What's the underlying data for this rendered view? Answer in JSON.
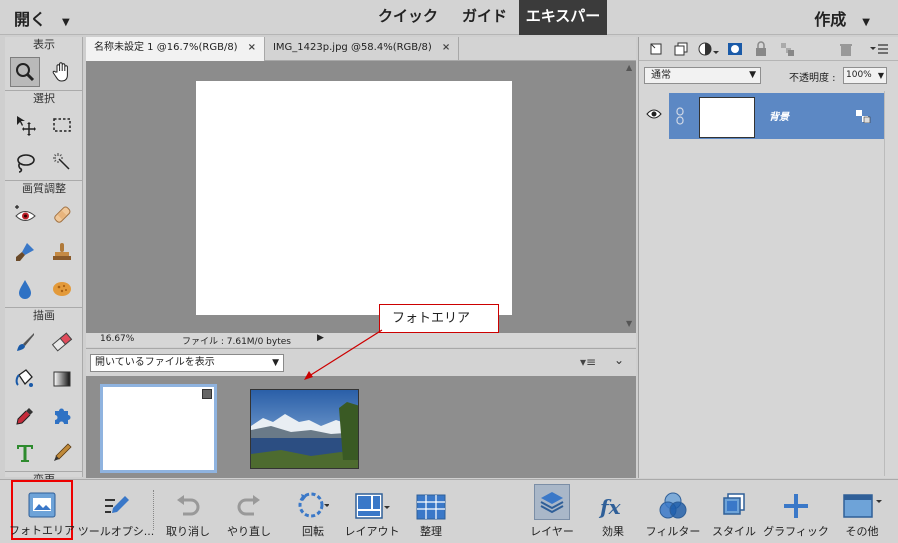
{
  "topbar": {
    "open_label": "開く",
    "modes": [
      "クイック",
      "ガイド",
      "エキスパート"
    ],
    "active_mode": "エキスパート",
    "create_label": "作成"
  },
  "toolbox": {
    "sections": {
      "view": "表示",
      "select": "選択",
      "enhance": "画質調整",
      "draw": "描画",
      "modify": "変更"
    }
  },
  "document": {
    "tabs": [
      {
        "label": "名称未設定 1 @16.7%(RGB/8)",
        "active": true
      },
      {
        "label": "IMG_1423p.jpg @58.4%(RGB/8)",
        "active": false
      }
    ],
    "status_zoom": "16.67%",
    "status_file": "ファイル : 7.61M/0 bytes"
  },
  "photobin": {
    "select_value": "開いているファイルを表示"
  },
  "callout": {
    "text": "フォトエリア"
  },
  "layers": {
    "blend_mode": "通常",
    "opacity_label": "不透明度 :",
    "opacity_value": "100%",
    "layer_name": "背景"
  },
  "bottombar": {
    "photo_area": "フォトエリア",
    "tool_options": "ツールオプシ...",
    "undo": "取り消し",
    "redo": "やり直し",
    "rotate": "回転",
    "layout": "レイアウト",
    "organize": "整理",
    "layers": "レイヤー",
    "effects": "効果",
    "filters": "フィルター",
    "styles": "スタイル",
    "graphics": "グラフィック",
    "more": "その他"
  },
  "colors": {
    "accent_blue": "#5c88c4",
    "callout_red": "#cc0000",
    "active_mode_bg": "#3b3b3b"
  }
}
